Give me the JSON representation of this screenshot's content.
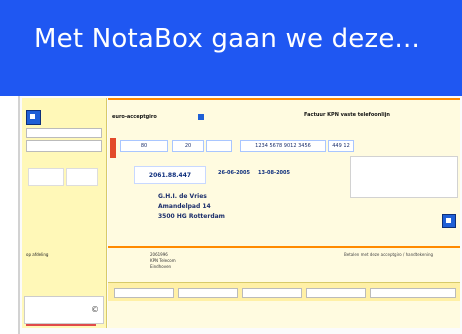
{
  "header": {
    "title": "Met NotaBox gaan we deze..."
  },
  "form": {
    "left_panel": {
      "label": "op afdeling"
    },
    "top": {
      "euro_label": "euro-acceptgiro",
      "invoice_title": "Factuur KPN vaste telefoonlijn"
    },
    "fields": {
      "field1": "80",
      "field2": "20",
      "field3": "1234 5678 9012 3456",
      "field4": "449 12",
      "amount": "2061.88.447",
      "date1": "26-06-2005",
      "date2": "13-08-2005"
    },
    "address": {
      "name": "G.H.I. de Vries",
      "street": "Amandelpad 14",
      "city": "3500 HG Rotterdam"
    },
    "rows": [
      {
        "k": "",
        "v": "2061996"
      },
      {
        "k": "",
        "v": "KPN Telecom"
      },
      {
        "k": "",
        "v": "Eindhoven"
      }
    ],
    "bottom_right": [
      "Betalen met deze acceptgiro / handtekening",
      "",
      ""
    ],
    "table": [
      {
        "label": ""
      },
      {
        "label": ""
      },
      {
        "label": ""
      },
      {
        "label": ""
      },
      {
        "label": ""
      }
    ]
  },
  "colors": {
    "header_blue": "#1f57f2",
    "panel_yellow": "#fff8b8",
    "orange_line": "#ff8a00",
    "accent_blue": "#1f5fd6",
    "accent_red": "#e34a2a"
  }
}
